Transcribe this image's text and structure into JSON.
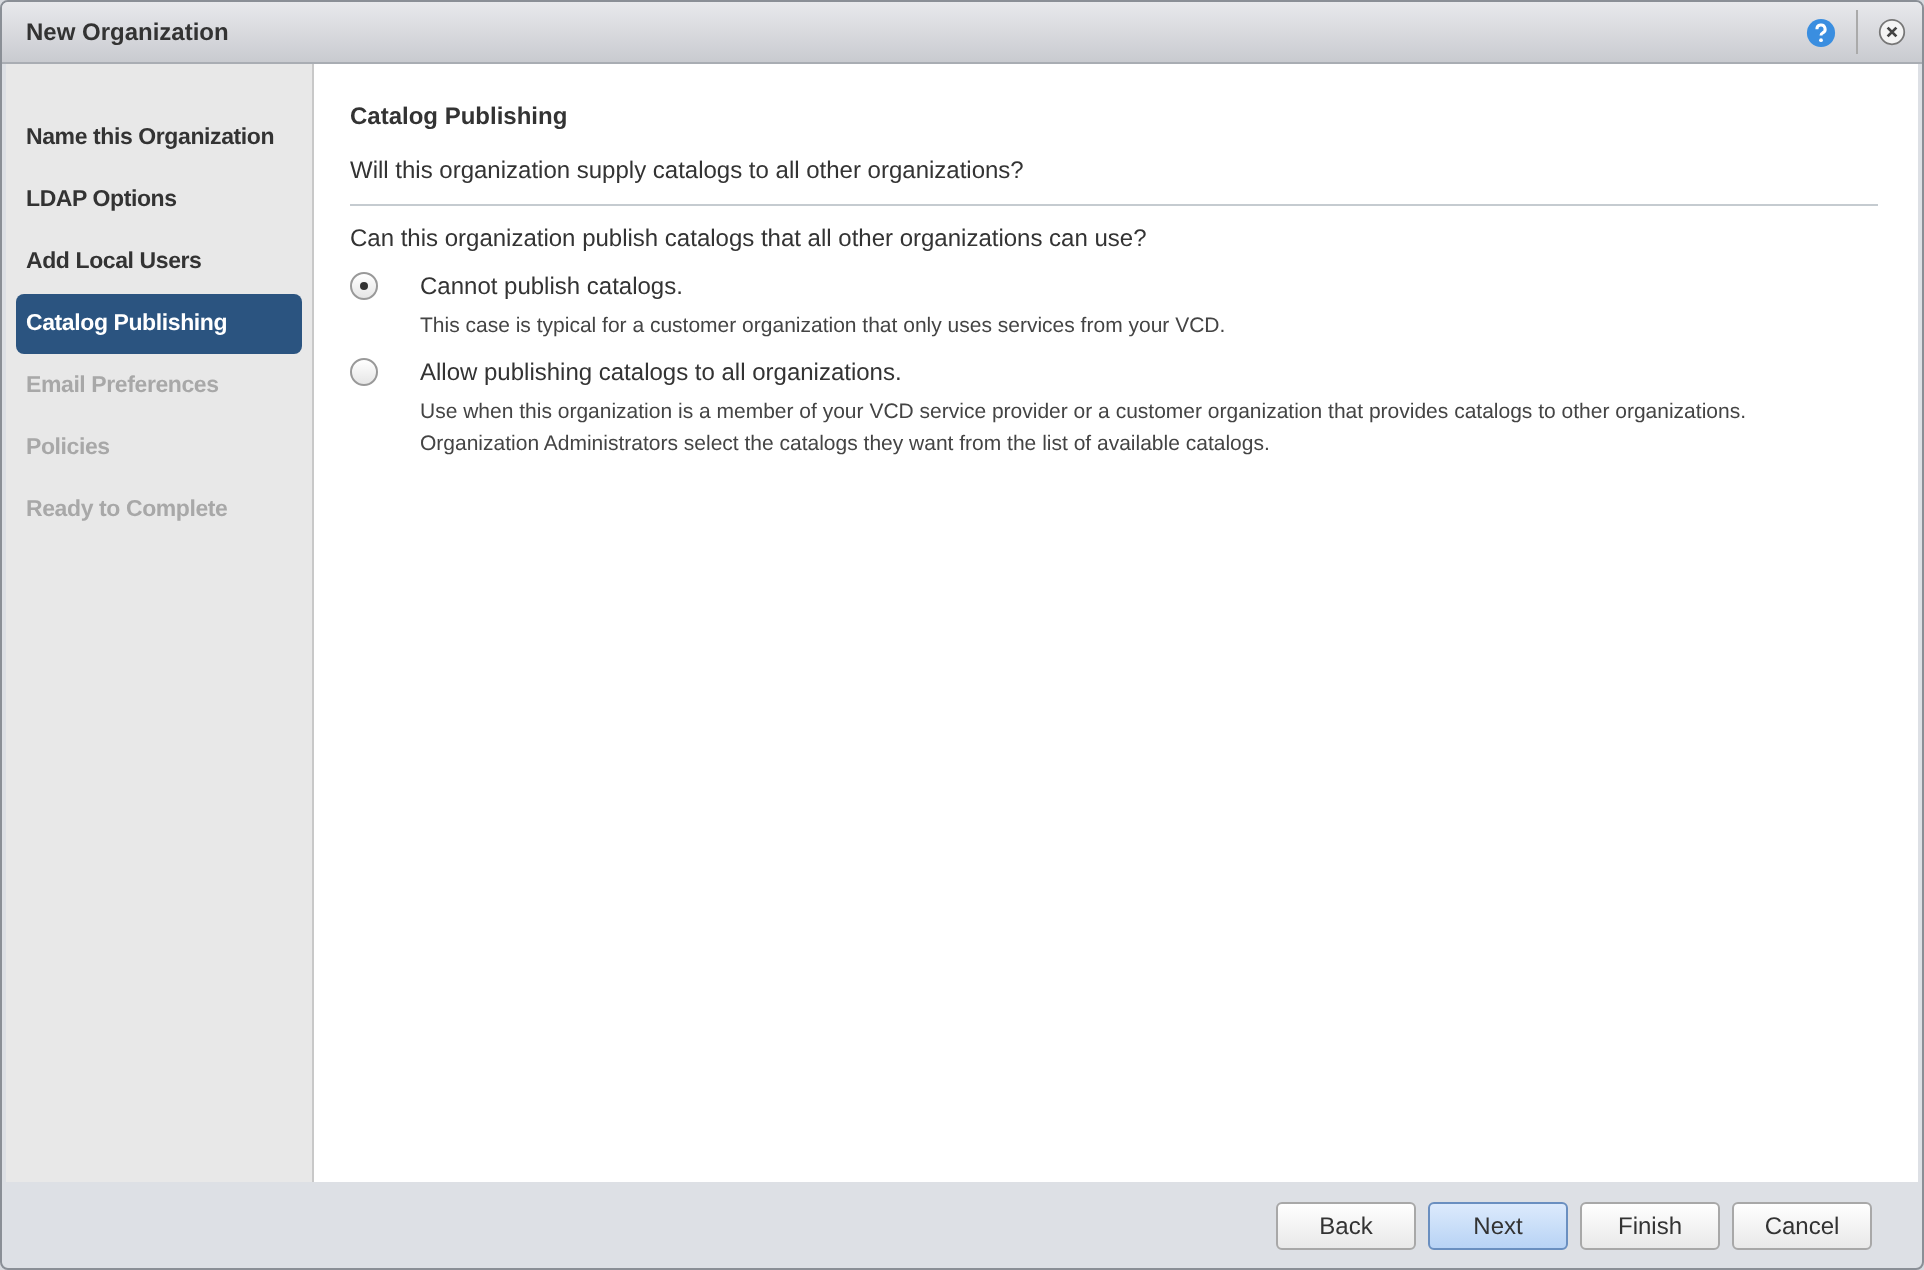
{
  "window": {
    "title": "New Organization"
  },
  "steps": [
    {
      "label": "Name this Organization",
      "selected": false,
      "disabled": false
    },
    {
      "label": "LDAP Options",
      "selected": false,
      "disabled": false
    },
    {
      "label": "Add Local Users",
      "selected": false,
      "disabled": false
    },
    {
      "label": "Catalog Publishing",
      "selected": true,
      "disabled": false
    },
    {
      "label": "Email Preferences",
      "selected": false,
      "disabled": true
    },
    {
      "label": "Policies",
      "selected": false,
      "disabled": true
    },
    {
      "label": "Ready to Complete",
      "selected": false,
      "disabled": true
    }
  ],
  "page": {
    "heading": "Catalog Publishing",
    "subtitle": "Will this organization supply catalogs to all other organizations?",
    "question": "Can this organization publish catalogs that all other organizations can use?",
    "options": [
      {
        "label": "Cannot publish catalogs.",
        "selected": true,
        "description": [
          "This case is typical for a customer organization that only uses services from your VCD."
        ]
      },
      {
        "label": "Allow publishing catalogs to all organizations.",
        "selected": false,
        "description": [
          "Use when this organization is a member of your VCD service provider or a customer organization that provides catalogs to other organizations.",
          "Organization Administrators select the catalogs they want from the list of available catalogs."
        ]
      }
    ]
  },
  "buttons": [
    {
      "label": "Back",
      "kind": "normal"
    },
    {
      "label": "Next",
      "kind": "primary"
    },
    {
      "label": "Finish",
      "kind": "normal"
    },
    {
      "label": "Cancel",
      "kind": "normal"
    }
  ]
}
